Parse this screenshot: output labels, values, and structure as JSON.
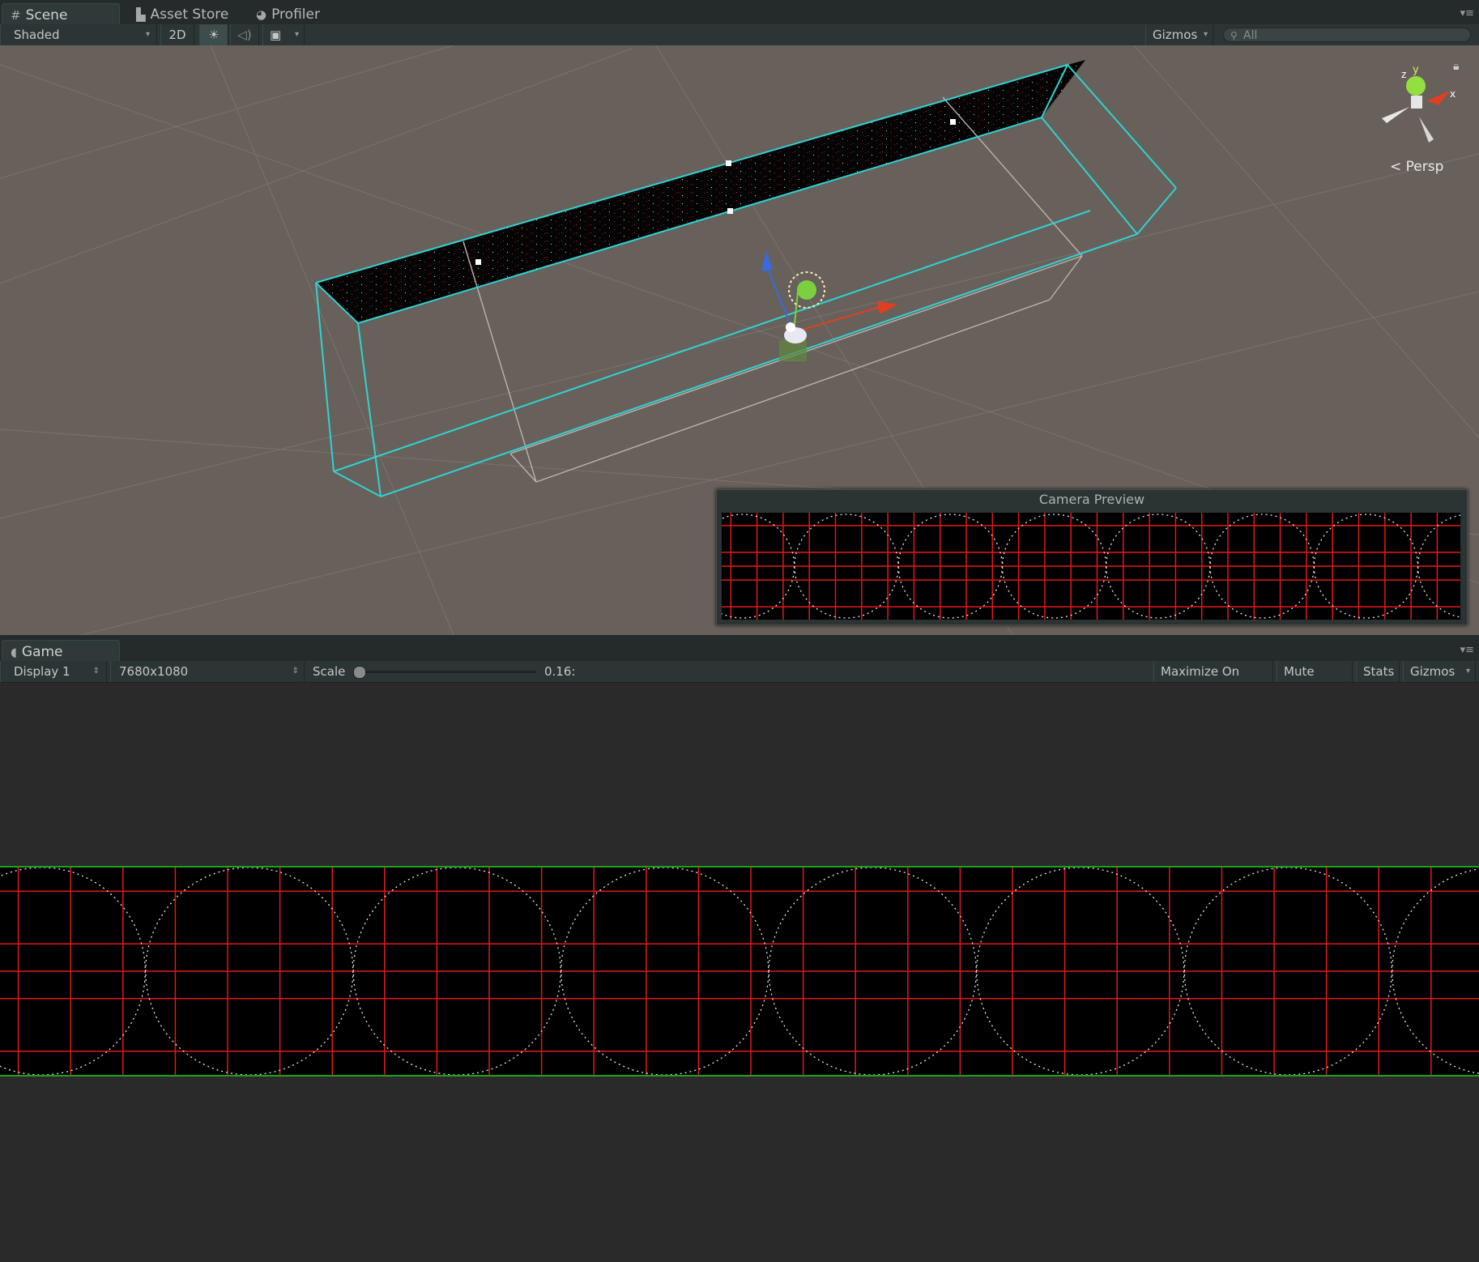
{
  "scene_panel": {
    "tabs": [
      {
        "label": "Scene",
        "icon": "hash-grid-icon"
      },
      {
        "label": "Asset Store",
        "icon": "shopping-bag-icon"
      },
      {
        "label": "Profiler",
        "icon": "profiler-icon"
      }
    ],
    "toolbar": {
      "draw_mode": "Shaded",
      "mode_2d": "2D",
      "lighting_icon": "sun-icon",
      "audio_icon": "speaker-icon",
      "effects_icon": "image-icon",
      "gizmos": "Gizmos",
      "search_placeholder": "All"
    },
    "gizmo": {
      "y": "y",
      "z": "z",
      "x": "x",
      "projection": "Persp"
    },
    "camera_preview": {
      "title": "Camera Preview"
    }
  },
  "game_panel": {
    "tab": {
      "label": "Game",
      "icon": "pacman-icon"
    },
    "toolbar": {
      "display": "Display 1",
      "resolution": "7680x1080",
      "scale_label": "Scale",
      "scale_value": "0.16:",
      "scale_slider_fraction": 0.0,
      "maximize_on_play": "Maximize On Play",
      "mute_audio": "Mute Audio",
      "stats": "Stats",
      "gizmos": "Gizmos"
    }
  },
  "colors": {
    "selection_outline": "#2fd3d3",
    "grid_red": "#e01a1a",
    "scene_background": "#68605a",
    "editor_dark": "#282828"
  }
}
